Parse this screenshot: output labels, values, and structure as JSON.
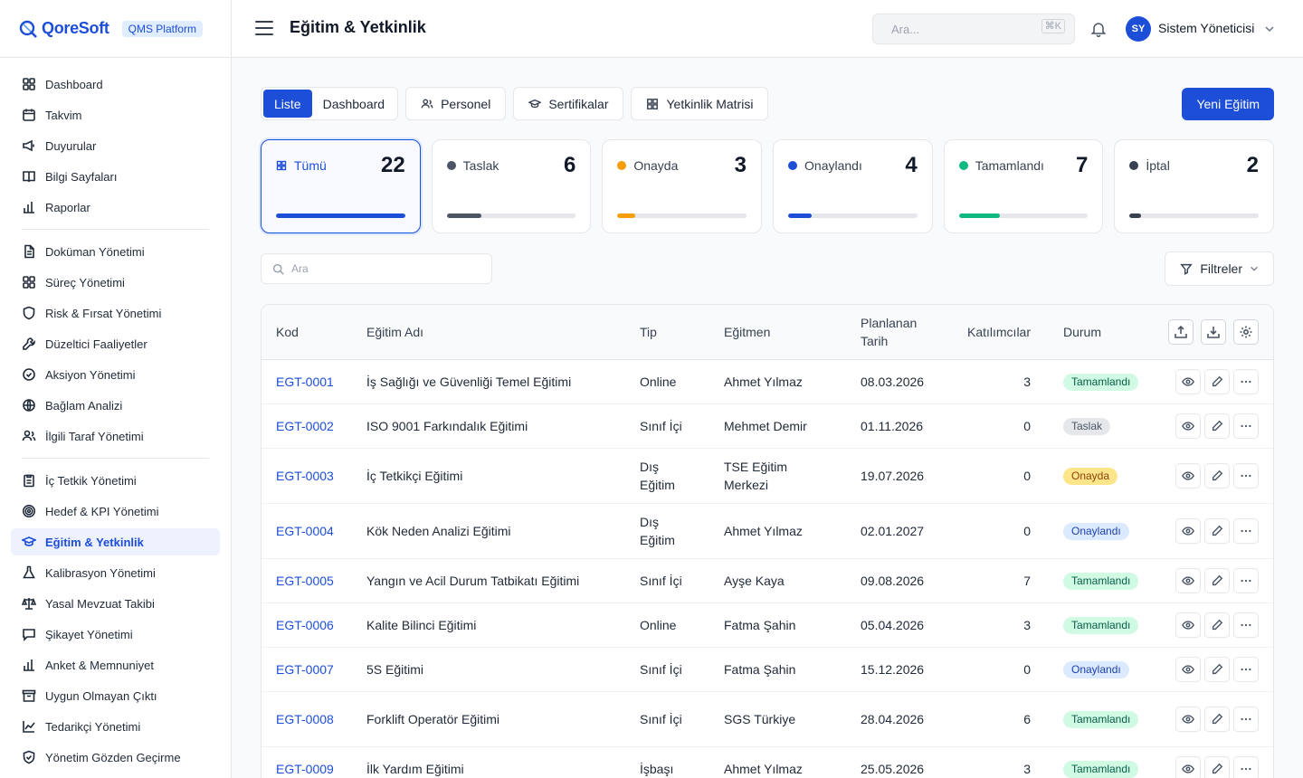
{
  "brand": {
    "name": "QoreSoft",
    "badge": "QMS Platform"
  },
  "sidebar": {
    "group1": [
      {
        "label": "Dashboard",
        "icon": "grid-icon"
      },
      {
        "label": "Takvim",
        "icon": "calendar-icon"
      },
      {
        "label": "Duyurular",
        "icon": "megaphone-icon"
      },
      {
        "label": "Bilgi Sayfaları",
        "icon": "book-icon"
      },
      {
        "label": "Raporlar",
        "icon": "bar-chart-icon"
      }
    ],
    "group2": [
      {
        "label": "Doküman Yönetimi",
        "icon": "document-icon"
      },
      {
        "label": "Süreç Yönetimi",
        "icon": "grid-icon"
      },
      {
        "label": "Risk & Fırsat Yönetimi",
        "icon": "shield-icon"
      },
      {
        "label": "Düzeltici Faaliyetler",
        "icon": "wrench-icon"
      },
      {
        "label": "Aksiyon Yönetimi",
        "icon": "check-circle-icon"
      },
      {
        "label": "Bağlam Analizi",
        "icon": "globe-icon"
      },
      {
        "label": "İlgili Taraf Yönetimi",
        "icon": "users-icon"
      }
    ],
    "group3": [
      {
        "label": "İç Tetkik Yönetimi",
        "icon": "clipboard-icon"
      },
      {
        "label": "Hedef & KPI Yönetimi",
        "icon": "target-icon"
      },
      {
        "label": "Eğitim & Yetkinlik",
        "icon": "graduation-cap-icon",
        "active": true
      },
      {
        "label": "Kalibrasyon Yönetimi",
        "icon": "flask-icon"
      },
      {
        "label": "Yasal Mevzuat Takibi",
        "icon": "scale-icon"
      },
      {
        "label": "Şikayet Yönetimi",
        "icon": "message-icon"
      },
      {
        "label": "Anket & Memnuniyet",
        "icon": "bar-chart-icon"
      },
      {
        "label": "Uygun Olmayan Çıktı",
        "icon": "archive-icon"
      },
      {
        "label": "Tedarikçi Yönetimi",
        "icon": "line-chart-icon"
      },
      {
        "label": "Yönetim Gözden Geçirme",
        "icon": "shield-check-icon"
      }
    ]
  },
  "header": {
    "title": "Eğitim & Yetkinlik",
    "search_placeholder": "Ara...",
    "search_shortcut": "⌘K",
    "avatar_initials": "SY",
    "user_name": "Sistem Yöneticisi"
  },
  "toolbar": {
    "view_tabs": [
      "Liste",
      "Dashboard"
    ],
    "buttons": [
      "Personel",
      "Sertifikalar",
      "Yetkinlik Matrisi"
    ],
    "new_button": "Yeni Eğitim"
  },
  "status_cards": [
    {
      "label": "Tümü",
      "count": "22",
      "fraction": 1.0,
      "color": "#1d4ed8",
      "dot": "grid"
    },
    {
      "label": "Taslak",
      "count": "6",
      "fraction": 0.27,
      "color": "#4b5563"
    },
    {
      "label": "Onayda",
      "count": "3",
      "fraction": 0.14,
      "color": "#f59e0b"
    },
    {
      "label": "Onaylandı",
      "count": "4",
      "fraction": 0.18,
      "color": "#1d4ed8"
    },
    {
      "label": "Tamamlandı",
      "count": "7",
      "fraction": 0.32,
      "color": "#10b981"
    },
    {
      "label": "İptal",
      "count": "2",
      "fraction": 0.09,
      "color": "#374151"
    }
  ],
  "filters": {
    "search_placeholder": "Ara",
    "filter_label": "Filtreler"
  },
  "table": {
    "columns": [
      "Kod",
      "Eğitim Adı",
      "Tip",
      "Eğitmen",
      "Planlanan Tarih",
      "Katılımcılar",
      "Durum"
    ],
    "rows": [
      {
        "code": "EGT-0001",
        "name": "İş Sağlığı ve Güvenliği Temel Eğitimi",
        "type": "Online",
        "trainer": "Ahmet Yılmaz",
        "date": "08.03.2026",
        "participants": "3",
        "status": "Tamamlandı",
        "status_class": "b-done"
      },
      {
        "code": "EGT-0002",
        "name": "ISO 9001 Farkındalık Eğitimi",
        "type": "Sınıf İçi",
        "trainer": "Mehmet Demir",
        "date": "01.11.2026",
        "participants": "0",
        "status": "Taslak",
        "status_class": "b-draft"
      },
      {
        "code": "EGT-0003",
        "name": "İç Tetkikçi Eğitimi",
        "type": "Dış Eğitim",
        "trainer": "TSE Eğitim Merkezi",
        "date": "19.07.2026",
        "participants": "0",
        "status": "Onayda",
        "status_class": "b-pend"
      },
      {
        "code": "EGT-0004",
        "name": "Kök Neden Analizi Eğitimi",
        "type": "Dış Eğitim",
        "trainer": "Ahmet Yılmaz",
        "date": "02.01.2027",
        "participants": "0",
        "status": "Onaylandı",
        "status_class": "b-appr"
      },
      {
        "code": "EGT-0005",
        "name": "Yangın ve Acil Durum Tatbikatı Eğitimi",
        "type": "Sınıf İçi",
        "trainer": "Ayşe Kaya",
        "date": "09.08.2026",
        "participants": "7",
        "status": "Tamamlandı",
        "status_class": "b-done"
      },
      {
        "code": "EGT-0006",
        "name": "Kalite Bilinci Eğitimi",
        "type": "Online",
        "trainer": "Fatma Şahin",
        "date": "05.04.2026",
        "participants": "3",
        "status": "Tamamlandı",
        "status_class": "b-done"
      },
      {
        "code": "EGT-0007",
        "name": "5S Eğitimi",
        "type": "Sınıf İçi",
        "trainer": "Fatma Şahin",
        "date": "15.12.2026",
        "participants": "0",
        "status": "Onaylandı",
        "status_class": "b-appr"
      },
      {
        "code": "EGT-0008",
        "name": "Forklift Operatör Eğitimi",
        "type": "Sınıf İçi",
        "trainer": "SGS Türkiye",
        "date": "28.04.2026",
        "participants": "6",
        "status": "Tamamlandı",
        "status_class": "b-done"
      },
      {
        "code": "EGT-0009",
        "name": "İlk Yardım Eğitimi",
        "type": "İşbaşı",
        "trainer": "Ahmet Yılmaz",
        "date": "25.05.2026",
        "participants": "3",
        "status": "Tamamlandı",
        "status_class": "b-done"
      }
    ]
  }
}
